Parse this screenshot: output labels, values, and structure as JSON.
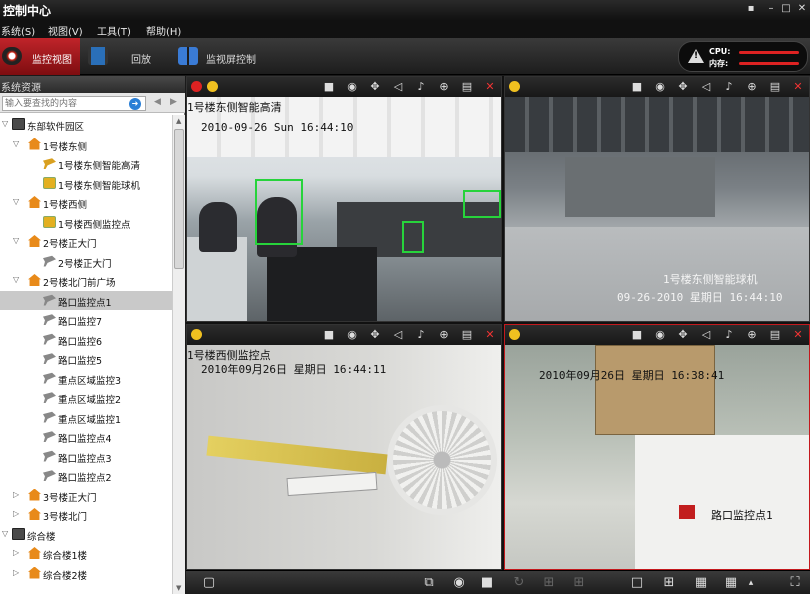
{
  "app": {
    "title": "控制中心"
  },
  "menu": [
    "系统(S)",
    "视图(V)",
    "工具(T)",
    "帮助(H)"
  ],
  "toolbar": {
    "tabs": [
      {
        "label": "监控视图",
        "active": true
      },
      {
        "label": "回放",
        "active": false
      },
      {
        "label": "监视屏控制",
        "active": false
      }
    ]
  },
  "perf": {
    "cpu_label": "CPU:",
    "mem_label": "内存:"
  },
  "sidebar": {
    "title": "系统资源",
    "search_placeholder": "输入要查找的内容",
    "tree": [
      {
        "label": "东部软件园区",
        "level": 0,
        "icon": "pc",
        "expanded": true
      },
      {
        "label": "1号楼东侧",
        "level": 1,
        "icon": "house",
        "expanded": true
      },
      {
        "label": "1号楼东侧智能高清",
        "level": 2,
        "icon": "camera-orange"
      },
      {
        "label": "1号楼东侧智能球机",
        "level": 2,
        "icon": "dome"
      },
      {
        "label": "1号楼西侧",
        "level": 1,
        "icon": "house",
        "expanded": true
      },
      {
        "label": "1号楼西侧监控点",
        "level": 2,
        "icon": "dome"
      },
      {
        "label": "2号楼正大门",
        "level": 1,
        "icon": "house",
        "expanded": true
      },
      {
        "label": "2号楼正大门",
        "level": 2,
        "icon": "camera"
      },
      {
        "label": "2号楼北门前广场",
        "level": 1,
        "icon": "house",
        "expanded": true
      },
      {
        "label": "路口监控点1",
        "level": 2,
        "icon": "camera",
        "selected": true
      },
      {
        "label": "路口监控7",
        "level": 2,
        "icon": "camera"
      },
      {
        "label": "路口监控6",
        "level": 2,
        "icon": "camera"
      },
      {
        "label": "路口监控5",
        "level": 2,
        "icon": "camera"
      },
      {
        "label": "重点区域监控3",
        "level": 2,
        "icon": "camera"
      },
      {
        "label": "重点区域监控2",
        "level": 2,
        "icon": "camera"
      },
      {
        "label": "重点区域监控1",
        "level": 2,
        "icon": "camera"
      },
      {
        "label": "路口监控点4",
        "level": 2,
        "icon": "camera"
      },
      {
        "label": "路口监控点3",
        "level": 2,
        "icon": "camera"
      },
      {
        "label": "路口监控点2",
        "level": 2,
        "icon": "camera"
      },
      {
        "label": "3号楼正大门",
        "level": 1,
        "icon": "house",
        "expanded": false
      },
      {
        "label": "3号楼北门",
        "level": 1,
        "icon": "house",
        "expanded": false
      },
      {
        "label": "综合楼",
        "level": 0,
        "icon": "pc",
        "expanded": true
      },
      {
        "label": "综合楼1楼",
        "level": 1,
        "icon": "house",
        "expanded": false
      },
      {
        "label": "综合楼2楼",
        "level": 1,
        "icon": "house",
        "expanded": false
      }
    ]
  },
  "panes": [
    {
      "name_osd": "1号楼东侧智能高清",
      "time_osd": "2010-09-26 Sun 16:44:10",
      "recording": true
    },
    {
      "name_osd": "1号楼东侧智能球机",
      "time_osd": "09-26-2010 星期日 16:44:10",
      "recording": false
    },
    {
      "name_osd": "1号楼西侧监控点",
      "time_osd": "2010年09月26日 星期日 16:44:11",
      "recording": false
    },
    {
      "name_osd": "路口监控点1",
      "time_osd": "2010年09月26日 星期日 16:38:41",
      "recording": false,
      "selected": true
    }
  ],
  "colors": {
    "accent": "#c4191d",
    "face_box": "#27d33b"
  }
}
